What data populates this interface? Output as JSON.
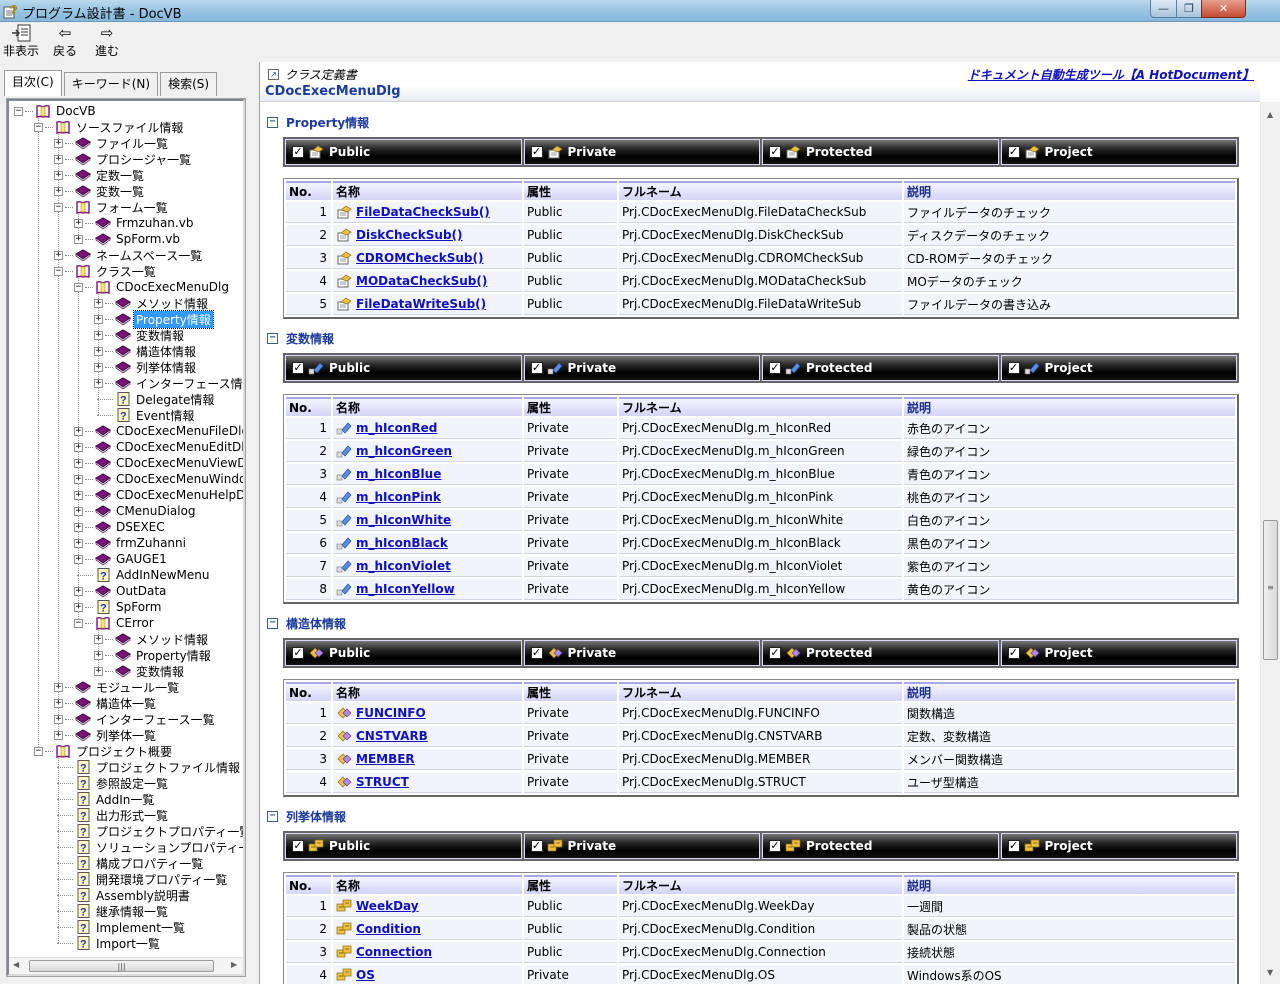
{
  "window": {
    "title": "プログラム設計書 - DocVB",
    "controls": {
      "minimize": "—",
      "maximize": "❐",
      "close": "✕"
    }
  },
  "toolbar": {
    "hide_label": "非表示",
    "back_label": "戻る",
    "forward_label": "進む"
  },
  "nav_tabs": [
    {
      "label": "目次(C)",
      "active": true
    },
    {
      "label": "キーワード(N)",
      "active": false
    },
    {
      "label": "検索(S)",
      "active": false
    }
  ],
  "tree": [
    {
      "label": "DocVB",
      "level": 0,
      "icon": "open-book",
      "expander": "minus"
    },
    {
      "label": "ソースファイル情報",
      "level": 1,
      "icon": "open-book",
      "expander": "minus"
    },
    {
      "label": "ファイル一覧",
      "level": 2,
      "icon": "book",
      "expander": "plus"
    },
    {
      "label": "プロシージャ一覧",
      "level": 2,
      "icon": "book",
      "expander": "plus"
    },
    {
      "label": "定数一覧",
      "level": 2,
      "icon": "book",
      "expander": "plus"
    },
    {
      "label": "変数一覧",
      "level": 2,
      "icon": "book",
      "expander": "plus"
    },
    {
      "label": "フォーム一覧",
      "level": 2,
      "icon": "open-book",
      "expander": "minus"
    },
    {
      "label": "Frmzuhan.vb",
      "level": 3,
      "icon": "book",
      "expander": "plus"
    },
    {
      "label": "SpForm.vb",
      "level": 3,
      "icon": "book",
      "expander": "plus"
    },
    {
      "label": "ネームスペース一覧",
      "level": 2,
      "icon": "book",
      "expander": "plus"
    },
    {
      "label": "クラス一覧",
      "level": 2,
      "icon": "open-book",
      "expander": "minus"
    },
    {
      "label": "CDocExecMenuDlg",
      "level": 3,
      "icon": "open-book",
      "expander": "minus"
    },
    {
      "label": "メソッド情報",
      "level": 4,
      "icon": "book",
      "expander": "plus"
    },
    {
      "label": "Property情報",
      "level": 4,
      "icon": "book",
      "expander": "plus",
      "selected": true
    },
    {
      "label": "変数情報",
      "level": 4,
      "icon": "book",
      "expander": "plus"
    },
    {
      "label": "構造体情報",
      "level": 4,
      "icon": "book",
      "expander": "plus"
    },
    {
      "label": "列挙体情報",
      "level": 4,
      "icon": "book",
      "expander": "plus"
    },
    {
      "label": "インターフェース情報",
      "level": 4,
      "icon": "book",
      "expander": "plus"
    },
    {
      "label": "Delegate情報",
      "level": 4,
      "icon": "help-page",
      "expander": "none"
    },
    {
      "label": "Event情報",
      "level": 4,
      "icon": "help-page",
      "expander": "none"
    },
    {
      "label": "CDocExecMenuFileDlg",
      "level": 3,
      "icon": "book",
      "expander": "plus"
    },
    {
      "label": "CDocExecMenuEditDlg",
      "level": 3,
      "icon": "book",
      "expander": "plus"
    },
    {
      "label": "CDocExecMenuViewDlg",
      "level": 3,
      "icon": "book",
      "expander": "plus"
    },
    {
      "label": "CDocExecMenuWindow",
      "level": 3,
      "icon": "book",
      "expander": "plus"
    },
    {
      "label": "CDocExecMenuHelpDlg",
      "level": 3,
      "icon": "book",
      "expander": "plus"
    },
    {
      "label": "CMenuDialog",
      "level": 3,
      "icon": "book",
      "expander": "plus"
    },
    {
      "label": "DSEXEC",
      "level": 3,
      "icon": "book",
      "expander": "plus"
    },
    {
      "label": "frmZuhanni",
      "level": 3,
      "icon": "book",
      "expander": "plus"
    },
    {
      "label": "GAUGE1",
      "level": 3,
      "icon": "book",
      "expander": "plus"
    },
    {
      "label": "AddInNewMenu",
      "level": 3,
      "icon": "help-page",
      "expander": "none"
    },
    {
      "label": "OutData",
      "level": 3,
      "icon": "book",
      "expander": "plus"
    },
    {
      "label": "SpForm",
      "level": 3,
      "icon": "help-page",
      "expander": "plus"
    },
    {
      "label": "CError",
      "level": 3,
      "icon": "open-book",
      "expander": "minus"
    },
    {
      "label": "メソッド情報",
      "level": 4,
      "icon": "book",
      "expander": "plus"
    },
    {
      "label": "Property情報",
      "level": 4,
      "icon": "book",
      "expander": "plus"
    },
    {
      "label": "変数情報",
      "level": 4,
      "icon": "book",
      "expander": "plus"
    },
    {
      "label": "モジュール一覧",
      "level": 2,
      "icon": "book",
      "expander": "plus"
    },
    {
      "label": "構造体一覧",
      "level": 2,
      "icon": "book",
      "expander": "plus"
    },
    {
      "label": "インターフェース一覧",
      "level": 2,
      "icon": "book",
      "expander": "plus"
    },
    {
      "label": "列挙体一覧",
      "level": 2,
      "icon": "book",
      "expander": "plus"
    },
    {
      "label": "プロジェクト概要",
      "level": 1,
      "icon": "open-book",
      "expander": "minus"
    },
    {
      "label": "プロジェクトファイル情報",
      "level": 2,
      "icon": "help-page",
      "expander": "none"
    },
    {
      "label": "参照設定一覧",
      "level": 2,
      "icon": "help-page",
      "expander": "none"
    },
    {
      "label": "AddIn一覧",
      "level": 2,
      "icon": "help-page",
      "expander": "none"
    },
    {
      "label": "出力形式一覧",
      "level": 2,
      "icon": "help-page",
      "expander": "none"
    },
    {
      "label": "プロジェクトプロパティ一覧",
      "level": 2,
      "icon": "help-page",
      "expander": "none"
    },
    {
      "label": "ソリューションプロパティ一覧",
      "level": 2,
      "icon": "help-page",
      "expander": "none"
    },
    {
      "label": "構成プロパティ一覧",
      "level": 2,
      "icon": "help-page",
      "expander": "none"
    },
    {
      "label": "開発環境プロパティ一覧",
      "level": 2,
      "icon": "help-page",
      "expander": "none"
    },
    {
      "label": "Assembly説明書",
      "level": 2,
      "icon": "help-page",
      "expander": "none"
    },
    {
      "label": "継承情報一覧",
      "level": 2,
      "icon": "help-page",
      "expander": "none"
    },
    {
      "label": "Implement一覧",
      "level": 2,
      "icon": "help-page",
      "expander": "none"
    },
    {
      "label": "Import一覧",
      "level": 2,
      "icon": "help-page",
      "expander": "none"
    }
  ],
  "doc": {
    "kind": "クラス定義書",
    "class_name": "CDocExecMenuDlg",
    "tool_link": "ドキュメント自動生成ツール【A HotDocument】",
    "columns": [
      "No.",
      "名称",
      "属性",
      "フルネーム",
      "説明"
    ],
    "filters": [
      "Public",
      "Private",
      "Protected",
      "Project"
    ],
    "sections": [
      {
        "title": "Property情報",
        "icon_kind": "property",
        "rows": [
          {
            "no": "1",
            "name": "FileDataCheckSub()",
            "attr": "Public",
            "fullname": "Prj.CDocExecMenuDlg.FileDataCheckSub",
            "desc": "ファイルデータのチェック"
          },
          {
            "no": "2",
            "name": "DiskCheckSub()",
            "attr": "Public",
            "fullname": "Prj.CDocExecMenuDlg.DiskCheckSub",
            "desc": "ディスクデータのチェック"
          },
          {
            "no": "3",
            "name": "CDROMCheckSub()",
            "attr": "Public",
            "fullname": "Prj.CDocExecMenuDlg.CDROMCheckSub",
            "desc": "CD-ROMデータのチェック"
          },
          {
            "no": "4",
            "name": "MODataCheckSub()",
            "attr": "Public",
            "fullname": "Prj.CDocExecMenuDlg.MODataCheckSub",
            "desc": "MOデータのチェック"
          },
          {
            "no": "5",
            "name": "FileDataWriteSub()",
            "attr": "Public",
            "fullname": "Prj.CDocExecMenuDlg.FileDataWriteSub",
            "desc": "ファイルデータの書き込み"
          }
        ]
      },
      {
        "title": "変数情報",
        "icon_kind": "variable",
        "rows": [
          {
            "no": "1",
            "name": "m_hIconRed",
            "attr": "Private",
            "fullname": "Prj.CDocExecMenuDlg.m_hIconRed",
            "desc": "赤色のアイコン"
          },
          {
            "no": "2",
            "name": "m_hIconGreen",
            "attr": "Private",
            "fullname": "Prj.CDocExecMenuDlg.m_hIconGreen",
            "desc": "緑色のアイコン"
          },
          {
            "no": "3",
            "name": "m_hIconBlue",
            "attr": "Private",
            "fullname": "Prj.CDocExecMenuDlg.m_hIconBlue",
            "desc": "青色のアイコン"
          },
          {
            "no": "4",
            "name": "m_hIconPink",
            "attr": "Private",
            "fullname": "Prj.CDocExecMenuDlg.m_hIconPink",
            "desc": "桃色のアイコン"
          },
          {
            "no": "5",
            "name": "m_hIconWhite",
            "attr": "Private",
            "fullname": "Prj.CDocExecMenuDlg.m_hIconWhite",
            "desc": "白色のアイコン"
          },
          {
            "no": "6",
            "name": "m_hIconBlack",
            "attr": "Private",
            "fullname": "Prj.CDocExecMenuDlg.m_hIconBlack",
            "desc": "黒色のアイコン"
          },
          {
            "no": "7",
            "name": "m_hIconViolet",
            "attr": "Private",
            "fullname": "Prj.CDocExecMenuDlg.m_hIconViolet",
            "desc": "紫色のアイコン"
          },
          {
            "no": "8",
            "name": "m_hIconYellow",
            "attr": "Private",
            "fullname": "Prj.CDocExecMenuDlg.m_hIconYellow",
            "desc": "黄色のアイコン"
          }
        ]
      },
      {
        "title": "構造体情報",
        "icon_kind": "struct",
        "rows": [
          {
            "no": "1",
            "name": "FUNCINFO",
            "attr": "Private",
            "fullname": "Prj.CDocExecMenuDlg.FUNCINFO",
            "desc": "関数構造"
          },
          {
            "no": "2",
            "name": "CNSTVARB",
            "attr": "Private",
            "fullname": "Prj.CDocExecMenuDlg.CNSTVARB",
            "desc": "定数、変数構造"
          },
          {
            "no": "3",
            "name": "MEMBER",
            "attr": "Private",
            "fullname": "Prj.CDocExecMenuDlg.MEMBER",
            "desc": "メンバー関数構造"
          },
          {
            "no": "4",
            "name": "STRUCT",
            "attr": "Private",
            "fullname": "Prj.CDocExecMenuDlg.STRUCT",
            "desc": "ユーザ型構造"
          }
        ]
      },
      {
        "title": "列挙体情報",
        "icon_kind": "enum",
        "rows": [
          {
            "no": "1",
            "name": "WeekDay",
            "attr": "Public",
            "fullname": "Prj.CDocExecMenuDlg.WeekDay",
            "desc": "一週間"
          },
          {
            "no": "2",
            "name": "Condition",
            "attr": "Public",
            "fullname": "Prj.CDocExecMenuDlg.Condition",
            "desc": "製品の状態"
          },
          {
            "no": "3",
            "name": "Connection",
            "attr": "Public",
            "fullname": "Prj.CDocExecMenuDlg.Connection",
            "desc": "接続状態"
          },
          {
            "no": "4",
            "name": "OS",
            "attr": "Private",
            "fullname": "Prj.CDocExecMenuDlg.OS",
            "desc": "Windows系のOS"
          }
        ]
      }
    ]
  },
  "colors": {
    "link": "#1010c0",
    "heading": "#1c3c9c",
    "tree_selected": "#3399ff",
    "book": "#6b0f6b"
  }
}
